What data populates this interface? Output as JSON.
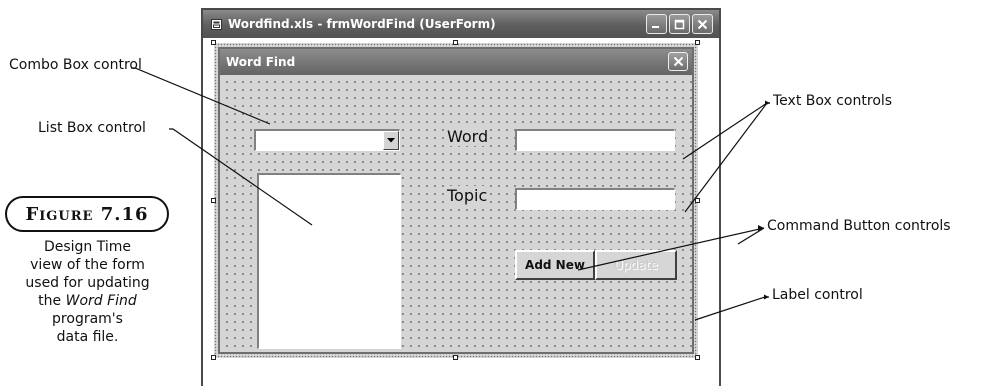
{
  "callouts": {
    "combo": "Combo Box control",
    "list": "List Box control",
    "textbox": "Text Box controls",
    "command": "Command Button controls",
    "label": "Label control"
  },
  "figure": {
    "badge": "Figure 7.16",
    "caption_1": "Design Time",
    "caption_2": "view of the form",
    "caption_3": "used for updating",
    "caption_4": "the",
    "caption_italic": "Word Find",
    "caption_5": "program's",
    "caption_6": "data file."
  },
  "vbe_window": {
    "title": "Wordfind.xls - frmWordFind (UserForm)",
    "app_icon": "vbe-userform-icon",
    "buttons": [
      "minimize-icon",
      "maximize-icon",
      "close-icon"
    ]
  },
  "form": {
    "title": "Word Find",
    "close_icon": "close-icon",
    "combo_value": "",
    "combo_icon": "chevron-down-icon",
    "word_label": "Word",
    "topic_label": "Topic",
    "word_value": "",
    "topic_value": "",
    "add_button": "Add New",
    "update_button": "Update",
    "update_enabled": false
  },
  "colors": {
    "titlebar": "#5e5e5e",
    "form_background": "#d5d5d5",
    "grid_dots": "#3a3a3a"
  }
}
